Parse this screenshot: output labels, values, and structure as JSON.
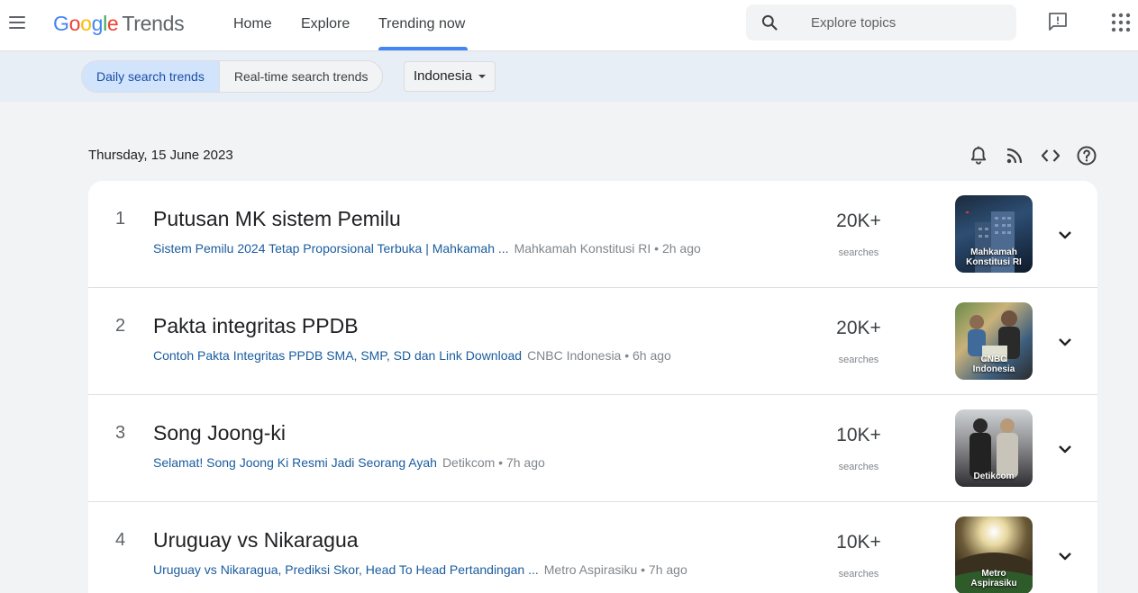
{
  "header": {
    "logo_google": [
      "G",
      "o",
      "o",
      "g",
      "l",
      "e"
    ],
    "logo_trends": "Trends",
    "nav": [
      "Home",
      "Explore",
      "Trending now"
    ],
    "search_placeholder": "Explore topics"
  },
  "toolbar": {
    "segments": [
      "Daily search trends",
      "Real-time search trends"
    ],
    "region": "Indonesia"
  },
  "date": "Thursday, 15 June 2023",
  "colors": {
    "accent": "#4285f4",
    "link": "#1a5c9e",
    "active_segment": "#d2e3fc"
  },
  "trends": [
    {
      "rank": "1",
      "title": "Putusan MK sistem Pemilu",
      "article": "Sistem Pemilu 2024 Tetap Proporsional Terbuka | Mahkamah ...",
      "source": "Mahkamah Konstitusi RI • 2h ago",
      "count": "20K+",
      "count_label": "searches",
      "thumb_caption": "Mahkamah Konstitusi RI"
    },
    {
      "rank": "2",
      "title": "Pakta integritas PPDB",
      "article": "Contoh Pakta Integritas PPDB SMA, SMP, SD dan Link Download",
      "source": "CNBC Indonesia • 6h ago",
      "count": "20K+",
      "count_label": "searches",
      "thumb_caption": "CNBC Indonesia"
    },
    {
      "rank": "3",
      "title": "Song Joong-ki",
      "article": "Selamat! Song Joong Ki Resmi Jadi Seorang Ayah",
      "source": "Detikcom • 7h ago",
      "count": "10K+",
      "count_label": "searches",
      "thumb_caption": "Detikcom"
    },
    {
      "rank": "4",
      "title": "Uruguay vs Nikaragua",
      "article": "Uruguay vs Nikaragua, Prediksi Skor, Head To Head Pertandingan ...",
      "source": "Metro Aspirasiku • 7h ago",
      "count": "10K+",
      "count_label": "searches",
      "thumb_caption": "Metro Aspirasiku"
    }
  ]
}
